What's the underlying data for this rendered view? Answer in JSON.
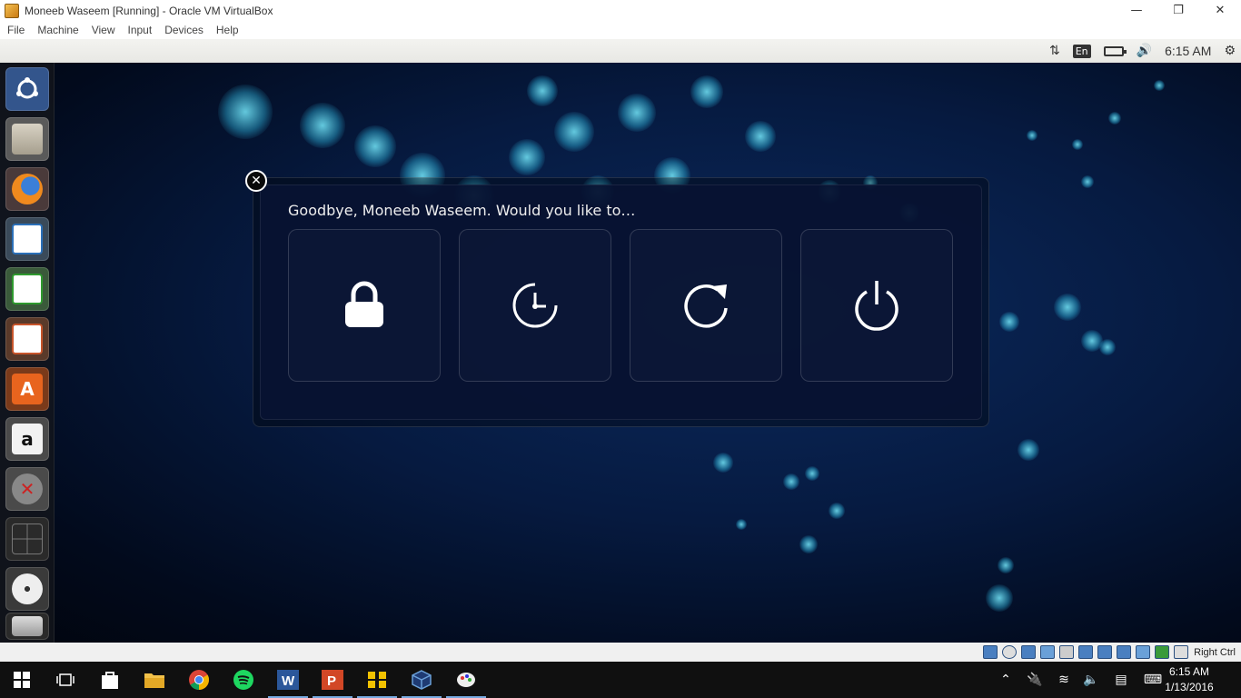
{
  "window": {
    "title": "Moneeb Waseem [Running] - Oracle VM VirtualBox",
    "minimize": "—",
    "restore": "❐",
    "close": "✕"
  },
  "menubar": [
    "File",
    "Machine",
    "View",
    "Input",
    "Devices",
    "Help"
  ],
  "ubuntu_panel": {
    "keyboard_lang": "En",
    "clock": "6:15 AM"
  },
  "launcher": {
    "items": [
      "Ubuntu Dash",
      "Files",
      "Firefox Web Browser",
      "LibreOffice Writer",
      "LibreOffice Calc",
      "LibreOffice Impress",
      "Ubuntu Software Center",
      "Amazon",
      "System Settings",
      "Workspace Switcher",
      "DVD",
      "Trash"
    ]
  },
  "dialog": {
    "title": "Goodbye, Moneeb Waseem. Would you like to…",
    "buttons": [
      "Lock",
      "Suspend",
      "Restart",
      "Shut Down"
    ]
  },
  "vbox_status": {
    "host_key": "Right Ctrl"
  },
  "taskbar": {
    "clock_time": "6:15 AM",
    "clock_date": "1/13/2016"
  }
}
